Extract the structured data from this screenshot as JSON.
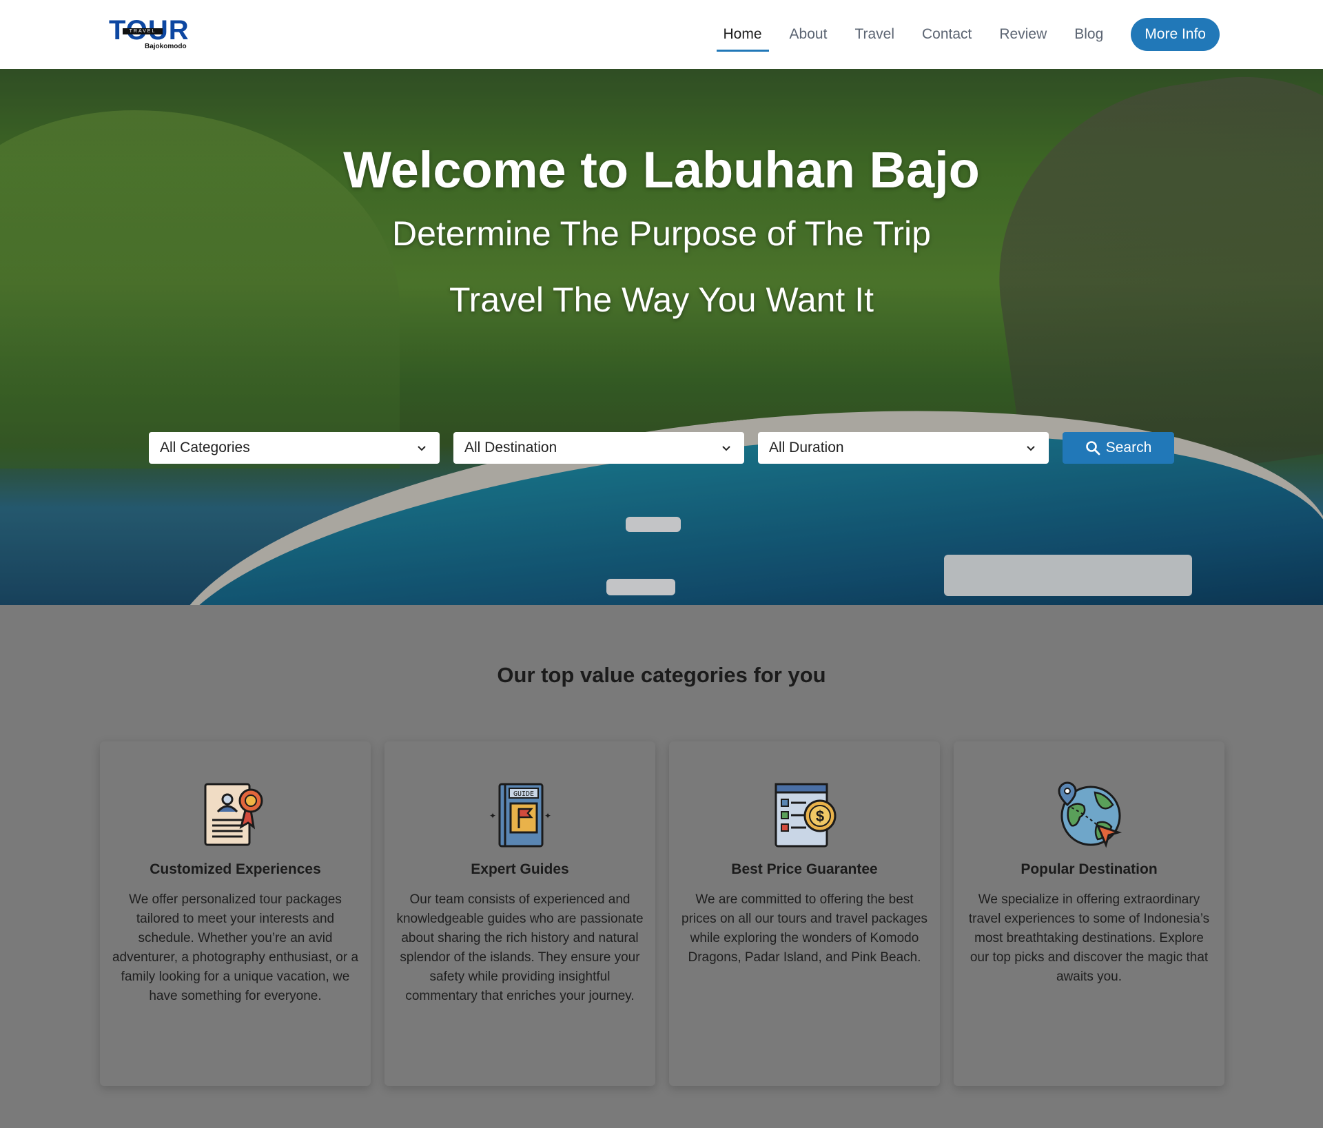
{
  "brand": {
    "logo_main": "TOUR",
    "logo_strip": "TRAVEL",
    "logo_sub": "Bajokomodo"
  },
  "nav": {
    "links": [
      "Home",
      "About",
      "Travel",
      "Contact",
      "Review",
      "Blog"
    ],
    "active": "Home",
    "cta": "More Info"
  },
  "hero": {
    "title": "Welcome to Labuhan Bajo",
    "subtitle": "Determine The Purpose of The Trip",
    "tagline": "Travel The Way You Want It"
  },
  "search": {
    "categories": "All Categories",
    "destination": "All Destination",
    "duration": "All Duration",
    "button": "Search",
    "icon": "search-icon"
  },
  "section": {
    "title": "Our top value categories for you"
  },
  "cards": [
    {
      "icon": "certificate-icon",
      "title": "Customized Experiences",
      "text": "We offer personalized tour packages tailored to meet your interests and schedule. Whether you’re an avid adventurer, a photography enthusiast, or a family looking for a unique vacation, we have something for everyone."
    },
    {
      "icon": "guide-book-icon",
      "title": "Expert Guides",
      "text": "Our team consists of experienced and knowledgeable guides who are passionate about sharing the rich history and natural splendor of the islands. They ensure your safety while providing insightful commentary that enriches your journey."
    },
    {
      "icon": "price-tag-icon",
      "title": "Best Price Guarantee",
      "text": "We are committed to offering the best prices on all our tours and travel packages while exploring the wonders of Komodo Dragons, Padar Island, and Pink Beach."
    },
    {
      "icon": "globe-pin-icon",
      "title": "Popular Destination",
      "text": "We specialize in offering extraordinary travel experiences to some of Indonesia’s most breathtaking destinations. Explore our top picks and discover the magic that awaits you."
    }
  ],
  "colors": {
    "primary": "#2178b8",
    "logo_blue": "#0d47a1",
    "section_bg": "#7a7a7a"
  }
}
